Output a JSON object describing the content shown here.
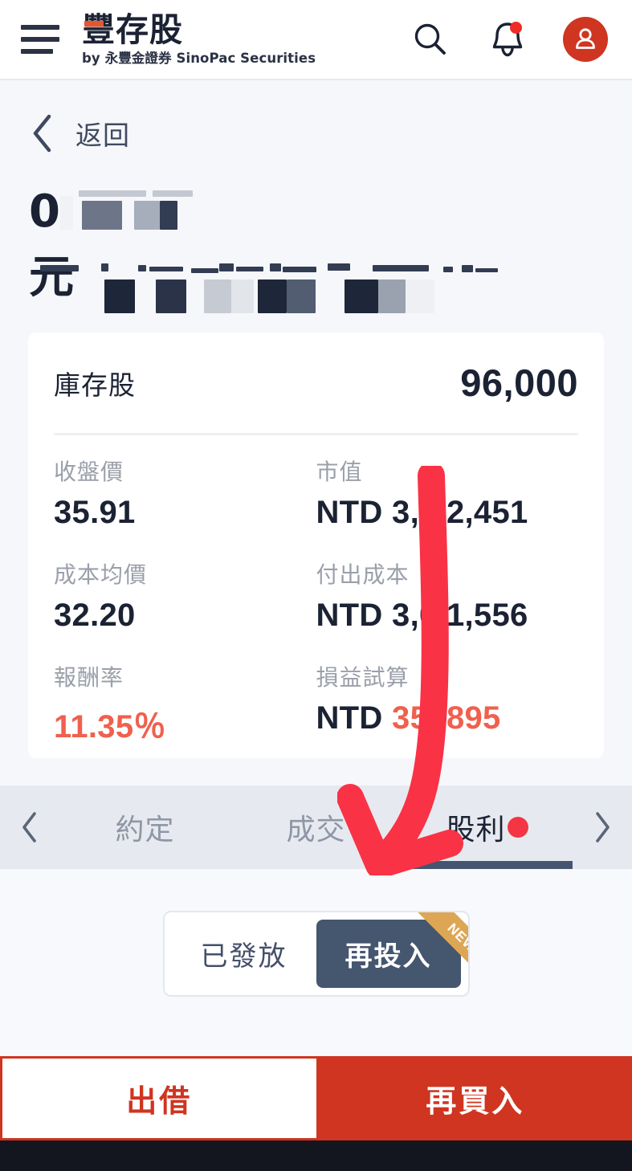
{
  "header": {
    "menu_icon": "hamburger-icon",
    "brand_title": "豐存股",
    "brand_subtitle": "by 永豐金證券 SinoPac Securities",
    "search_icon": "search-icon",
    "notifications_icon": "bell-icon",
    "account_icon": "user-avatar-icon",
    "has_notification_badge": true
  },
  "navigation": {
    "back_label": "返回",
    "back_icon": "chevron-left-icon"
  },
  "page_title": {
    "line1_visible": "0",
    "line2_visible": "元",
    "redacted": true
  },
  "summary_card": {
    "holdings_label": "庫存股",
    "holdings_value": "96,000",
    "metrics": [
      {
        "label": "收盤價",
        "value": "35.91",
        "accent": false
      },
      {
        "label": "市值",
        "value": "NTD 3,4 2,451",
        "accent": false
      },
      {
        "label": "成本均價",
        "value": "32.20",
        "accent": false
      },
      {
        "label": "付出成本",
        "value": "NTD 3,0 1,556",
        "accent": false
      },
      {
        "label": "報酬率",
        "value": "11.35％",
        "accent": true
      },
      {
        "label": "損益試算",
        "prefix": "NTD ",
        "value": "35 ,895",
        "accent": "partial"
      }
    ]
  },
  "tabbar": {
    "prev_icon": "chevron-left-icon",
    "next_icon": "chevron-right-icon",
    "tabs": [
      {
        "label": "約定",
        "active": false,
        "badge": false
      },
      {
        "label": "成交",
        "active": false,
        "badge": false
      },
      {
        "label": "股利",
        "active": true,
        "badge": true
      }
    ]
  },
  "segmented_control": {
    "options": [
      {
        "label": "已發放",
        "active": false
      },
      {
        "label": "再投入",
        "active": true
      }
    ],
    "ribbon_label": "NEW"
  },
  "action_bar": {
    "secondary_label": "出借",
    "primary_label": "再買入"
  },
  "annotation": {
    "type": "arrow",
    "color": "#fa3246",
    "points_to": "股利"
  },
  "colors": {
    "brand_red": "#cf3520",
    "accent_red": "#f0604d",
    "badge_red": "#f43644",
    "dark_navy": "#1b2233",
    "tab_active": "#46556f",
    "ribbon_gold": "#dda655",
    "page_bg": "#f5f7fa",
    "tabbar_bg": "#e6eaf0"
  }
}
